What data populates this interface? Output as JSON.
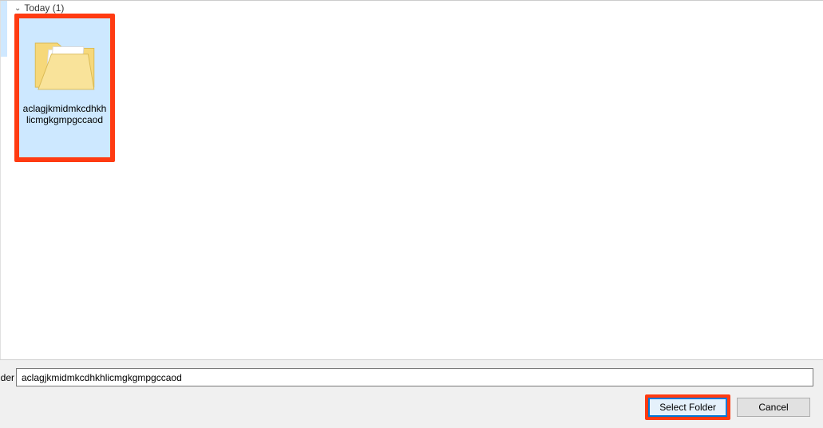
{
  "group": {
    "label": "Today (1)"
  },
  "folder": {
    "name": "aclagjkmidmkcdhkhlicmgkgmpgccaod"
  },
  "footer": {
    "field_label": "Folder:",
    "field_label_visible": "der:",
    "field_value": "aclagjkmidmkcdhkhlicmgkgmpgccaod",
    "select_label": "Select Folder",
    "cancel_label": "Cancel"
  },
  "highlight_color": "#ff3b12"
}
